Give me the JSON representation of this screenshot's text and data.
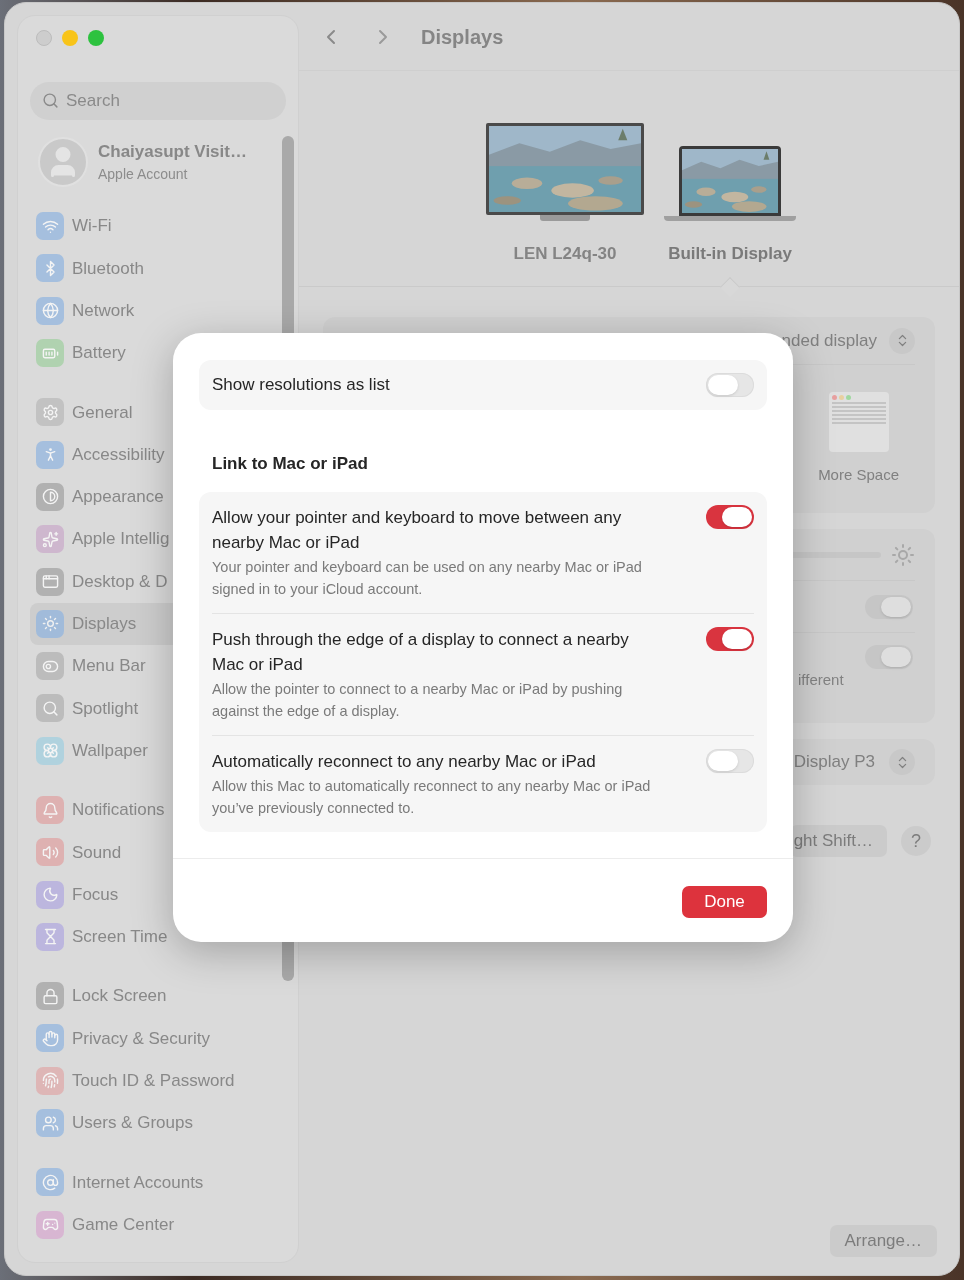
{
  "window": {
    "title": "Displays"
  },
  "sidebar": {
    "search": {
      "placeholder": "Search"
    },
    "account": {
      "name": "Chaiyasupt Visit…",
      "subtitle": "Apple Account"
    },
    "groups": [
      {
        "items": [
          {
            "label": "Wi-Fi",
            "selected": false
          },
          {
            "label": "Bluetooth",
            "selected": false
          },
          {
            "label": "Network",
            "selected": false
          },
          {
            "label": "Battery",
            "selected": false
          }
        ]
      },
      {
        "items": [
          {
            "label": "General",
            "selected": false
          },
          {
            "label": "Accessibility",
            "selected": false
          },
          {
            "label": "Appearance",
            "selected": false
          },
          {
            "label": "Apple Intellig",
            "selected": false
          },
          {
            "label": "Desktop & D",
            "selected": false
          },
          {
            "label": "Displays",
            "selected": true
          },
          {
            "label": "Menu Bar",
            "selected": false
          },
          {
            "label": "Spotlight",
            "selected": false
          },
          {
            "label": "Wallpaper",
            "selected": false
          }
        ]
      },
      {
        "items": [
          {
            "label": "Notifications",
            "selected": false
          },
          {
            "label": "Sound",
            "selected": false
          },
          {
            "label": "Focus",
            "selected": false
          },
          {
            "label": "Screen Time",
            "selected": false
          }
        ]
      },
      {
        "items": [
          {
            "label": "Lock Screen",
            "selected": false
          },
          {
            "label": "Privacy & Security",
            "selected": false
          },
          {
            "label": "Touch ID & Password",
            "selected": false
          },
          {
            "label": "Users & Groups",
            "selected": false
          }
        ]
      },
      {
        "items": [
          {
            "label": "Internet Accounts",
            "selected": false
          },
          {
            "label": "Game Center",
            "selected": false
          }
        ]
      }
    ]
  },
  "displays": [
    {
      "name": "LEN L24q-30",
      "kind": "monitor",
      "selected": false
    },
    {
      "name": "Built-in Display",
      "kind": "laptop",
      "selected": true
    }
  ],
  "settings": {
    "use_as": "nded display",
    "more_space": "More Space",
    "toggles": [
      {
        "on": true
      },
      {
        "on": true,
        "caption": "ifferent"
      }
    ],
    "color_profile": "Display P3",
    "night_shift": "ght Shift…",
    "help": "?",
    "arrange": "Arrange…"
  },
  "sheet": {
    "rows": [
      {
        "title": "Show resolutions as list",
        "on": false
      }
    ],
    "section": "Link to Mac or iPad",
    "link_rows": [
      {
        "title": "Allow your pointer and keyboard to move between any nearby Mac or iPad",
        "description": "Your pointer and keyboard can be used on any nearby Mac or iPad signed in to your iCloud account.",
        "on": true
      },
      {
        "title": "Push through the edge of a display to connect a nearby Mac or iPad",
        "description": "Allow the pointer to connect to a nearby Mac or iPad by pushing against the edge of a display.",
        "on": true
      },
      {
        "title": "Automatically reconnect to any nearby Mac or iPad",
        "description": "Allow this Mac to automatically reconnect to any nearby Mac or iPad you’ve previously connected to.",
        "on": false
      }
    ],
    "done": "Done"
  }
}
